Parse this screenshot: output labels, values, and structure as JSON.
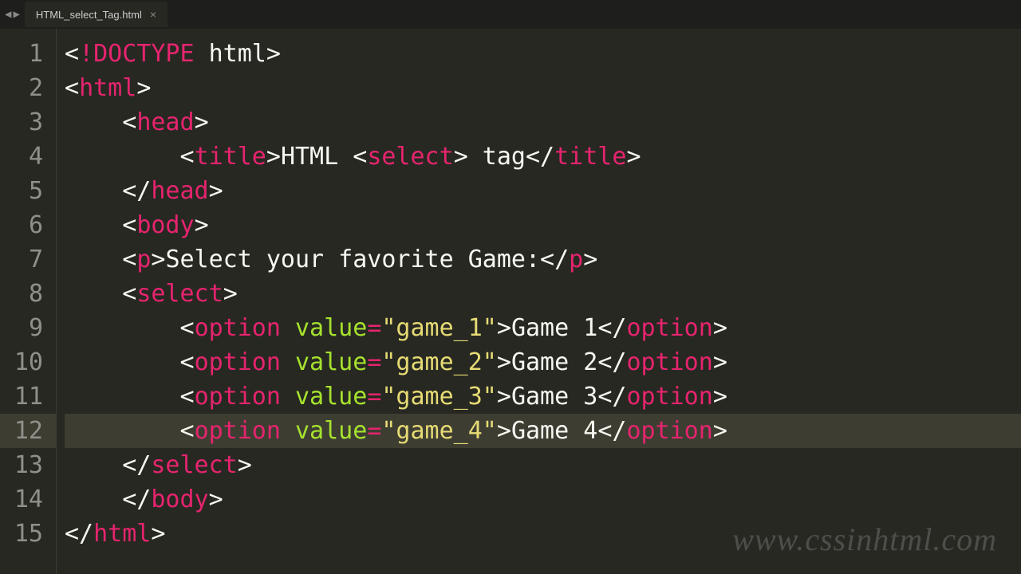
{
  "tab": {
    "filename": "HTML_select_Tag.html"
  },
  "gutter": [
    "1",
    "2",
    "3",
    "4",
    "5",
    "6",
    "7",
    "8",
    "9",
    "10",
    "11",
    "12",
    "13",
    "14",
    "15"
  ],
  "active_line": 12,
  "code": {
    "l1": {
      "doctype": "!DOCTYPE",
      "html": "html"
    },
    "l2": {
      "tag": "html"
    },
    "l3": {
      "tag": "head"
    },
    "l4": {
      "tag": "title",
      "txt1": "HTML ",
      "txt2": " tag",
      "nested": "select"
    },
    "l5": {
      "tag": "head"
    },
    "l6": {
      "tag": "body"
    },
    "l7": {
      "tag": "p",
      "txt": "Select your favorite Game:"
    },
    "l8": {
      "tag": "select"
    },
    "l9": {
      "tag": "option",
      "attr": "value",
      "val": "\"game_1\"",
      "txt": "Game 1"
    },
    "l10": {
      "tag": "option",
      "attr": "value",
      "val": "\"game_2\"",
      "txt": "Game 2"
    },
    "l11": {
      "tag": "option",
      "attr": "value",
      "val": "\"game_3\"",
      "txt": "Game 3"
    },
    "l12": {
      "tag": "option",
      "attr": "value",
      "val": "\"game_4\"",
      "txt": "Game 4"
    },
    "l13": {
      "tag": "select"
    },
    "l14": {
      "tag": "body"
    },
    "l15": {
      "tag": "html"
    }
  },
  "watermark": "www.cssinhtml.com"
}
